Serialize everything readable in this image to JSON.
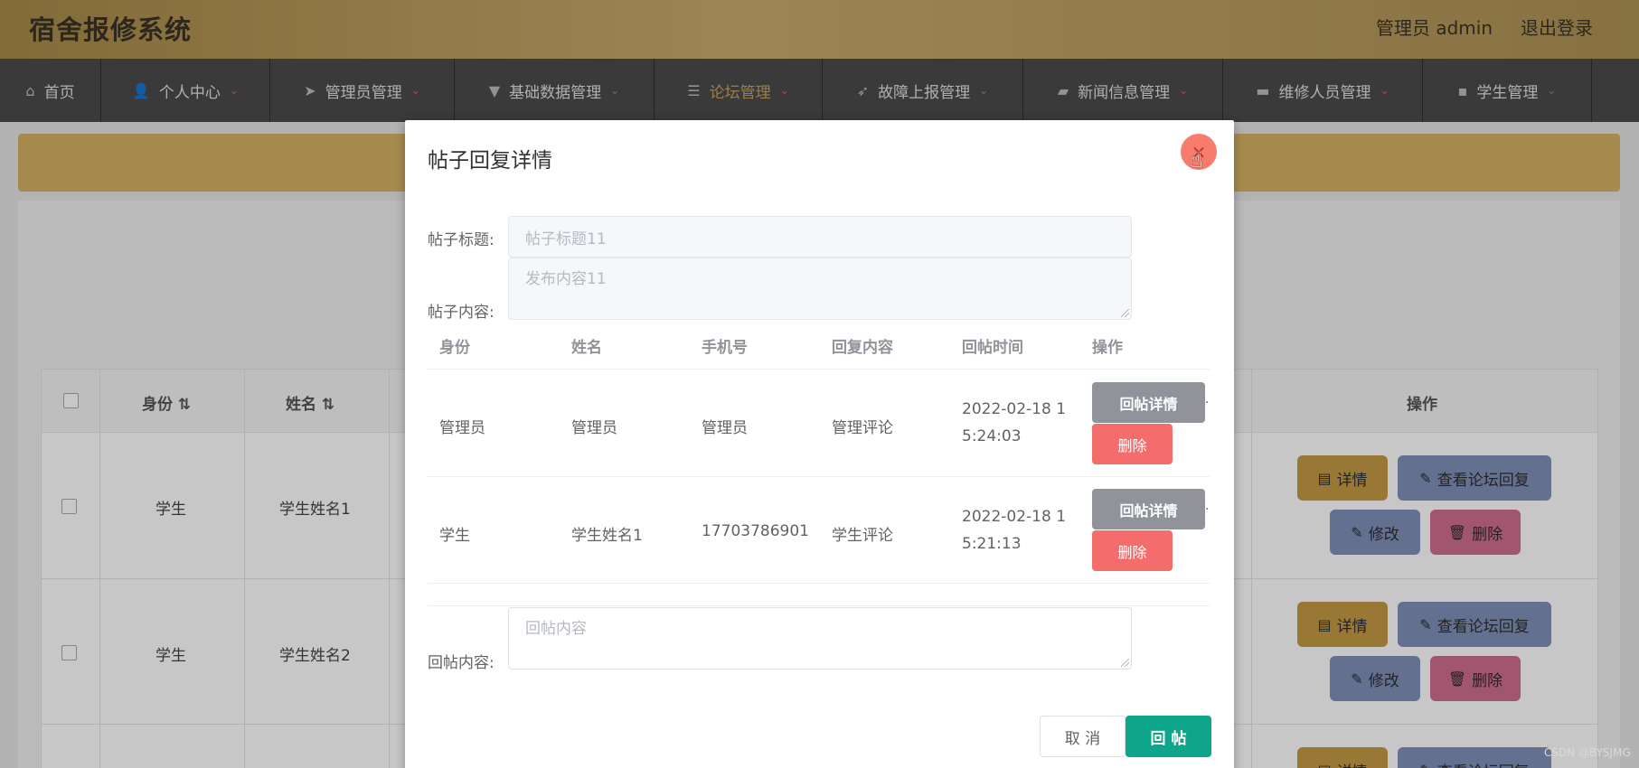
{
  "header": {
    "title": "宿舍报修系统",
    "user": "管理员 admin",
    "logout": "退出登录"
  },
  "nav": [
    {
      "label": "首页",
      "icon": "home-icon"
    },
    {
      "label": "个人中心",
      "icon": "user-icon"
    },
    {
      "label": "管理员管理",
      "icon": "send-icon"
    },
    {
      "label": "基础数据管理",
      "icon": "pin-icon"
    },
    {
      "label": "论坛管理",
      "icon": "sliders-icon"
    },
    {
      "label": "故障上报管理",
      "icon": "location-arrow-icon"
    },
    {
      "label": "新闻信息管理",
      "icon": "news-icon"
    },
    {
      "label": "维修人员管理",
      "icon": "monitor-icon"
    },
    {
      "label": "学生管理",
      "icon": "chat-icon"
    }
  ],
  "background_table": {
    "headers": {
      "identity": "身份",
      "name": "姓名",
      "action": "操作"
    },
    "rows": [
      {
        "identity": "学生",
        "name": "学生姓名1"
      },
      {
        "identity": "学生",
        "name": "学生姓名2"
      }
    ],
    "buttons": {
      "detail": "详情",
      "view_replies": "查看论坛回复",
      "edit": "修改",
      "delete": "删除"
    }
  },
  "dialog": {
    "title": "帖子回复详情",
    "post_title_label": "帖子标题:",
    "post_title_value": "帖子标题11",
    "post_content_label": "帖子内容:",
    "post_content_value": "发布内容11",
    "table": {
      "headers": [
        "身份",
        "姓名",
        "手机号",
        "回复内容",
        "回帖时间",
        "操作"
      ],
      "rows": [
        {
          "identity": "管理员",
          "name": "管理员",
          "phone": "管理员",
          "content": "管理评论",
          "time_line1": "2022-02-18 1",
          "time_line2": "5:24:03"
        },
        {
          "identity": "学生",
          "name": "学生姓名1",
          "phone": "17703786901",
          "content": "学生评论",
          "time_line1": "2022-02-18 1",
          "time_line2": "5:21:13"
        }
      ],
      "detail_button": "回帖详情",
      "delete_button": "删除"
    },
    "reply_label": "回帖内容:",
    "reply_placeholder": "回帖内容",
    "cancel_button": "取 消",
    "submit_button": "回 帖"
  },
  "watermark": "CSDN @BYSJMG"
}
